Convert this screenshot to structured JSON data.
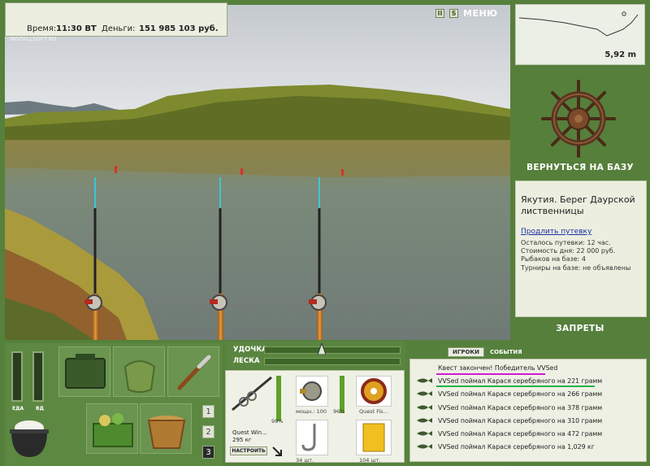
{
  "status": {
    "time_label": "Время:",
    "time_value": "11:30 ВТ",
    "money_label": "Деньги:",
    "money_value": "151 985 103 руб."
  },
  "watermark": "INSTALLSOFT.RU",
  "controls": {
    "pause_glyph": "II",
    "sound_glyph": "S",
    "menu_label": "МЕНЮ"
  },
  "depth": {
    "value": "5,92 m"
  },
  "navigation": {
    "return_label": "ВЕРНУТЬСЯ НА БАЗУ",
    "bans_label": "ЗАПРЕТЫ"
  },
  "location": {
    "title": "Якутия. Берег Даурской лиственницы",
    "extend_link": "Продлить путевку",
    "lines": [
      "Осталось путевки: 12 час.",
      "Стоимость дня: 22 000 руб.",
      "Рыбаков на базе: 4",
      "Турниры на базе: не объявлены"
    ]
  },
  "meters": {
    "food_label": "ЕДА",
    "vodka_label": "ВД",
    "food_level": 0.0,
    "vodka_level": 0.0
  },
  "tabs": [
    "1",
    "2",
    "3"
  ],
  "active_tab": "3",
  "gear": {
    "rod_label": "УДОЧКА",
    "line_label": "ЛЕСКА",
    "rod_name": "Quest Win...",
    "rod_weight": "295 кг",
    "rod_percent": "99%",
    "reel_power": "мощн.: 100",
    "reel_percent": "96%",
    "line_name": "Quest Fis...",
    "hook_count": "34 шт.",
    "bait_count": "104 шт.",
    "tune_label": "НАСТРОИТЬ"
  },
  "chat": {
    "tab_players": "ИГРОКИ",
    "tab_events": "СОБЫТИЯ",
    "quest_message": "Квест закончен! Победитель VVSed",
    "catches": [
      "VVSed поймал Карася серебряного на 221 грамм",
      "VVSed поймал Карася серебряного на 266 грамм",
      "VVSed поймал Карася серебряного на 378 грамм",
      "VVSed поймал Карася серебряного на 310 грамм",
      "VVSed поймал Карася серебряного на 472 грамм",
      "VVSed поймал Карася серебряного на 1,029 кг"
    ]
  },
  "colors": {
    "panel_green": "#567f3b",
    "accent_magenta": "#d11ad5",
    "accent_green": "#18b34a"
  }
}
